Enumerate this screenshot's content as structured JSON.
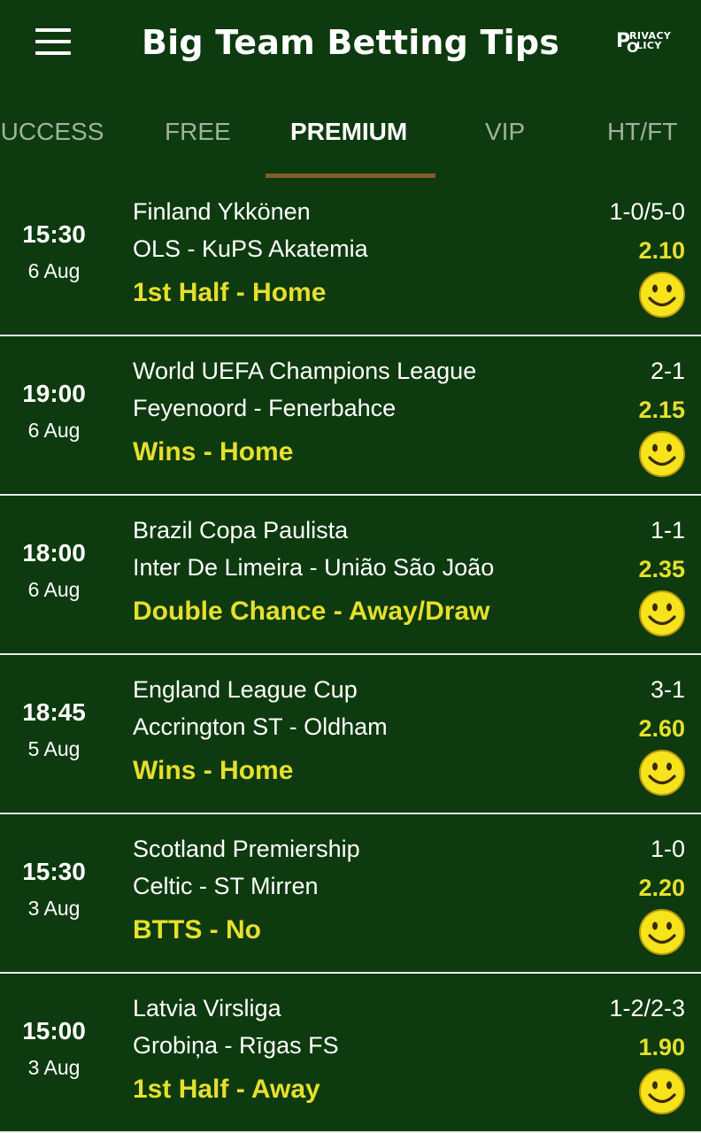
{
  "app_bar": {
    "title": "Big Team Betting Tips",
    "privacy": {
      "p": "P",
      "rivacy": "RIVACY",
      "o": "O",
      "olicy": "LICY"
    }
  },
  "tabs": [
    {
      "label": "SUCCESS",
      "active": false
    },
    {
      "label": "FREE",
      "active": false
    },
    {
      "label": "PREMIUM",
      "active": true
    },
    {
      "label": "VIP",
      "active": false
    },
    {
      "label": "HT/FT",
      "active": false
    }
  ],
  "colors": {
    "background": "#0e3a0f",
    "accent_yellow": "#e6df2d",
    "tab_indicator": "#8a5a2b",
    "smile_face": "#f6e31c"
  },
  "tips": [
    {
      "time": "15:30",
      "date": "6 Aug",
      "league": "Finland Ykkönen",
      "match": "OLS - KuPS Akatemia",
      "prediction": "1st Half - Home",
      "score": "1-0/5-0",
      "odds": "2.10",
      "result_icon": "smile-icon"
    },
    {
      "time": "19:00",
      "date": "6 Aug",
      "league": "World UEFA Champions League",
      "match": "Feyenoord - Fenerbahce",
      "prediction": "Wins - Home",
      "score": "2-1",
      "odds": "2.15",
      "result_icon": "smile-icon"
    },
    {
      "time": "18:00",
      "date": "6 Aug",
      "league": "Brazil Copa Paulista",
      "match": "Inter De Limeira - União São João",
      "prediction": "Double Chance - Away/Draw",
      "score": "1-1",
      "odds": "2.35",
      "result_icon": "smile-icon"
    },
    {
      "time": "18:45",
      "date": "5 Aug",
      "league": "England League Cup",
      "match": "Accrington ST - Oldham",
      "prediction": "Wins - Home",
      "score": "3-1",
      "odds": "2.60",
      "result_icon": "smile-icon"
    },
    {
      "time": "15:30",
      "date": "3 Aug",
      "league": "Scotland Premiership",
      "match": "Celtic - ST Mirren",
      "prediction": "BTTS - No",
      "score": "1-0",
      "odds": "2.20",
      "result_icon": "smile-icon"
    },
    {
      "time": "15:00",
      "date": "3 Aug",
      "league": "Latvia Virsliga",
      "match": "Grobiņa - Rīgas FS",
      "prediction": "1st Half - Away",
      "score": "1-2/2-3",
      "odds": "1.90",
      "result_icon": "smile-icon"
    }
  ]
}
